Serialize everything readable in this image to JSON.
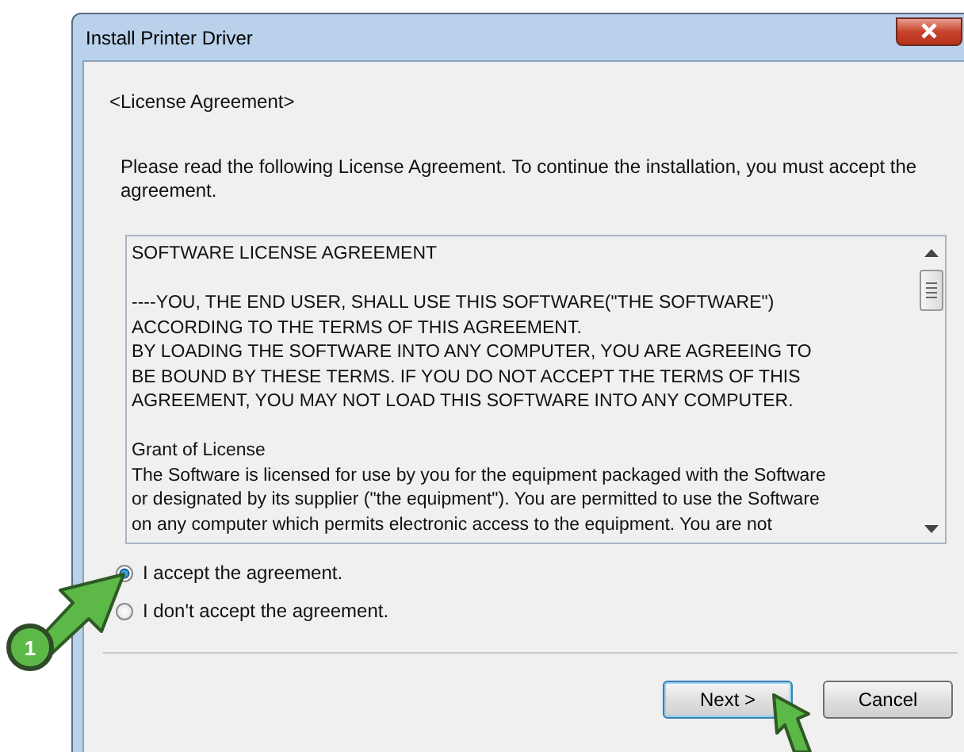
{
  "window": {
    "title": "Install Printer Driver"
  },
  "section_heading": "<License Agreement>",
  "instructions": "Please read the following License Agreement. To continue the installation, you must accept the agreement.",
  "license": {
    "paragraphs": [
      {
        "lines": [
          "SOFTWARE LICENSE AGREEMENT"
        ]
      },
      {
        "lines": [
          "----YOU, THE END USER, SHALL USE THIS SOFTWARE(\"THE SOFTWARE\")",
          "ACCORDING TO THE TERMS OF THIS AGREEMENT.",
          "BY LOADING THE SOFTWARE INTO ANY COMPUTER, YOU ARE AGREEING TO",
          "BE BOUND BY THESE TERMS. IF YOU DO NOT ACCEPT THE TERMS OF THIS",
          "AGREEMENT, YOU MAY NOT LOAD THIS SOFTWARE INTO ANY COMPUTER."
        ]
      },
      {
        "lines": [
          "Grant of License",
          "The Software is licensed for use by you for the equipment packaged with the Software",
          "or designated by its supplier (\"the equipment\"). You are permitted to use the Software",
          "on any computer which permits electronic access to the equipment. You are not"
        ]
      }
    ]
  },
  "options": [
    {
      "label": "I accept the agreement.",
      "selected": true
    },
    {
      "label": "I don't accept the agreement.",
      "selected": false
    }
  ],
  "buttons": [
    {
      "label": "Next >",
      "default": true
    },
    {
      "label": "Cancel",
      "default": false
    }
  ],
  "callouts": [
    {
      "label": "1"
    }
  ]
}
